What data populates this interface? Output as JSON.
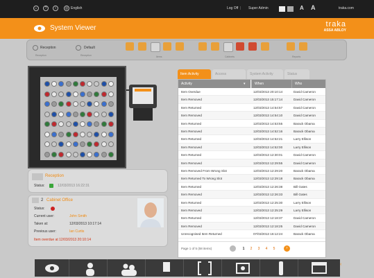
{
  "topbar": {
    "language": "English",
    "logoff": "Log Off",
    "user": "Super Admin",
    "font_small": "A",
    "font_large": "A",
    "site": "traka.com"
  },
  "header": {
    "title": "System Viewer",
    "brand": "traka",
    "brand_sub": "ASSA ABLOY"
  },
  "toolbar": {
    "reception_label": "Reception",
    "reception_sub": "Reception",
    "default_label": "Default",
    "default_sub": "Reception",
    "group_items": "Items",
    "group_cabinet": "Cabinets",
    "group_reports": "Reports"
  },
  "cabinet_panel": {
    "name": "Reception",
    "status_label": "Status:",
    "timestamp": "12/03/2013 16:22:31"
  },
  "item_panel": {
    "number": "2",
    "name": "Cabinet Office",
    "status_label": "Status:",
    "current_user_label": "Current user:",
    "current_user": "John Smith",
    "taken_at_label": "Taken at:",
    "taken_at": "12/03/2013 10:17:14",
    "previous_user_label": "Previous user:",
    "previous_user": "Ian Curtis",
    "overdue_text": "Item overdue at 12/03/2013 20:10:14"
  },
  "tabs": [
    "Item Activity",
    "Access",
    "System Activity",
    "Status"
  ],
  "table": {
    "columns": [
      "Activity",
      "When",
      "Who"
    ],
    "rows": [
      [
        "Item Overdue",
        "12/03/2013 20:10:14",
        "David Cameron"
      ],
      [
        "Item Removed",
        "12/03/2013 15:17:14",
        "David Cameron"
      ],
      [
        "Item Returned",
        "12/03/2013 14:54:57",
        "David Cameron"
      ],
      [
        "Item Removed",
        "12/03/2013 14:54:10",
        "David Cameron"
      ],
      [
        "Item Returned",
        "12/03/2013 14:53:55",
        "Barack Obama"
      ],
      [
        "Item Removed",
        "12/03/2013 14:52:16",
        "Barack Obama"
      ],
      [
        "Item Returned",
        "12/03/2013 14:52:21",
        "Larry Ellison"
      ],
      [
        "Item Removed",
        "12/03/2013 14:52:00",
        "Larry Ellison"
      ],
      [
        "Item Returned",
        "12/03/2013 12:30:01",
        "David Cameron"
      ],
      [
        "Item Removed",
        "12/03/2013 12:29:55",
        "David Cameron"
      ],
      [
        "Item Removed From Wrong Slot",
        "12/03/2013 12:29:20",
        "Barack Obama"
      ],
      [
        "Item Returned To Wrong Slot",
        "12/03/2013 12:29:18",
        "Barack Obama"
      ],
      [
        "Item Returned",
        "12/03/2013 12:26:38",
        "Bill Gates"
      ],
      [
        "Item Removed",
        "12/03/2013 12:26:33",
        "Bill Gates"
      ],
      [
        "Item Returned",
        "12/03/2013 12:25:30",
        "Larry Ellison"
      ],
      [
        "Item Removed",
        "12/03/2013 12:25:29",
        "Larry Ellison"
      ],
      [
        "Item Returned",
        "12/03/2013 12:18:37",
        "David Cameron"
      ],
      [
        "Item Removed",
        "12/03/2013 12:18:25",
        "David Cameron"
      ],
      [
        "Unrecognised Item Returned",
        "07/03/2013 16:12:24",
        "Barack Obama"
      ]
    ],
    "pagination_text": "Page 1 of 5 (58 items)",
    "pages": [
      "1",
      "2",
      "3",
      "4",
      "5"
    ]
  },
  "colors": {
    "accent": "#f39019",
    "topbar": "#1e1e1e",
    "table_header": "#8e8e8e",
    "status_green": "#3aa63a",
    "status_red": "#cc2222"
  }
}
